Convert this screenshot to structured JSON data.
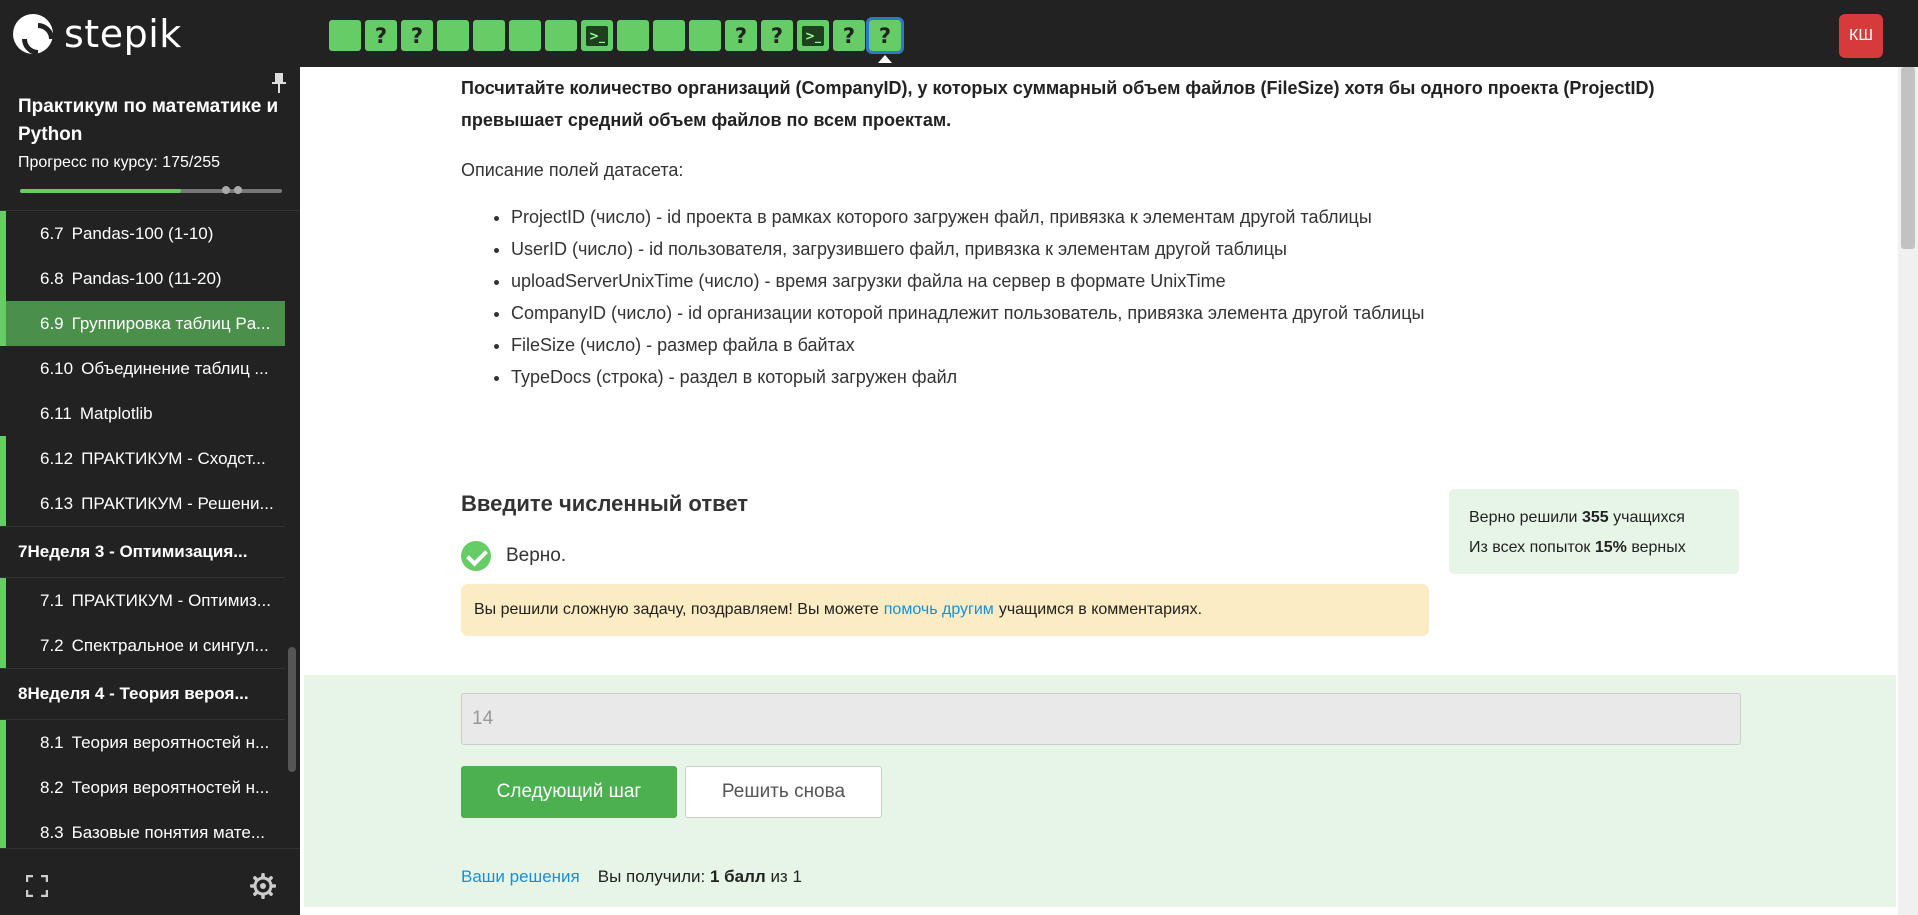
{
  "header": {
    "logo_text": "stepik",
    "steps": [
      {
        "kind": "done",
        "label": ""
      },
      {
        "kind": "quiz",
        "label": "?"
      },
      {
        "kind": "quiz",
        "label": "?"
      },
      {
        "kind": "done",
        "label": ""
      },
      {
        "kind": "done",
        "label": ""
      },
      {
        "kind": "done",
        "label": ""
      },
      {
        "kind": "done",
        "label": ""
      },
      {
        "kind": "code",
        "label": ""
      },
      {
        "kind": "done",
        "label": ""
      },
      {
        "kind": "done",
        "label": ""
      },
      {
        "kind": "done",
        "label": ""
      },
      {
        "kind": "quiz",
        "label": "?"
      },
      {
        "kind": "quiz",
        "label": "?"
      },
      {
        "kind": "code",
        "label": ""
      },
      {
        "kind": "quiz",
        "label": "?"
      },
      {
        "kind": "quiz-active",
        "label": "?"
      }
    ],
    "user_initials": "КШ"
  },
  "sidebar": {
    "course_title": "Практикум по математике и Python",
    "progress_label": "Прогресс по курсу:  175/255",
    "progress_value": 0.686,
    "items": [
      {
        "type": "step",
        "num": "6.7",
        "label": "Pandas-100 (1-10)",
        "state": "done"
      },
      {
        "type": "step",
        "num": "6.8",
        "label": "Pandas-100 (11-20)",
        "state": "done"
      },
      {
        "type": "step",
        "num": "6.9",
        "label": "Группировка таблиц Pa...",
        "state": "current"
      },
      {
        "type": "step",
        "num": "6.10",
        "label": "Объединение таблиц ...",
        "state": "inactive"
      },
      {
        "type": "step",
        "num": "6.11",
        "label": "Matplotlib",
        "state": "inactive"
      },
      {
        "type": "step",
        "num": "6.12",
        "label": "ПРАКТИКУМ - Сходст...",
        "state": "done"
      },
      {
        "type": "step",
        "num": "6.13",
        "label": "ПРАКТИКУМ - Решени...",
        "state": "done"
      },
      {
        "type": "section",
        "num": "7",
        "label": "Неделя 3 - Оптимизация..."
      },
      {
        "type": "step",
        "num": "7.1",
        "label": "ПРАКТИКУМ - Оптимиз...",
        "state": "done"
      },
      {
        "type": "step",
        "num": "7.2",
        "label": "Спектральное и сингул...",
        "state": "done"
      },
      {
        "type": "section",
        "num": "8",
        "label": "Неделя 4 - Теория вероя..."
      },
      {
        "type": "step",
        "num": "8.1",
        "label": "Теория вероятностей н...",
        "state": "done"
      },
      {
        "type": "step",
        "num": "8.2",
        "label": "Теория вероятностей н...",
        "state": "done"
      },
      {
        "type": "step",
        "num": "8.3",
        "label": "Базовые понятия мате...",
        "state": "done"
      }
    ]
  },
  "main": {
    "task": "Посчитайте количество организаций (CompanyID), у которых суммарный объем файлов (FileSize) хотя бы одного проекта (ProjectID) превышает средний объем файлов по всем проектам.",
    "desc_title": "Описание полей датасета:",
    "fields": [
      "ProjectID (число) - id проекта в рамках которого загружен файл, привязка к элементам другой таблицы",
      "UserID (число) - id пользователя, загрузившего файл, привязка к элементам другой таблицы",
      "uploadServerUnixTime (число) - время загрузки файла на сервер в формате UnixTime",
      "CompanyID (число) - id организации которой принадлежит пользователь, привязка элемента другой таблицы",
      "FileSize (число) - размер файла в байтах",
      "TypeDocs (строка) - раздел в который загружен файл"
    ],
    "answer_header": "Введите численный ответ",
    "correct_text": "Верно.",
    "congrats_before": "Вы решили сложную задачу, поздравляем! Вы можете",
    "congrats_link": "помочь другим",
    "congrats_after": "учащимся в комментариях.",
    "stats": {
      "line1_prefix": "Верно решили",
      "solved_count": "355",
      "line1_suffix": "учащихся",
      "line2_prefix": "Из всех попыток",
      "percent": "15%",
      "line2_suffix": "верных"
    },
    "answer_value": "14",
    "next_button": "Следующий шаг",
    "retry_button": "Решить снова",
    "solutions_link": "Ваши решения",
    "score_prefix": "Вы получили:",
    "score_value": "1 балл",
    "score_suffix": "из 1"
  }
}
